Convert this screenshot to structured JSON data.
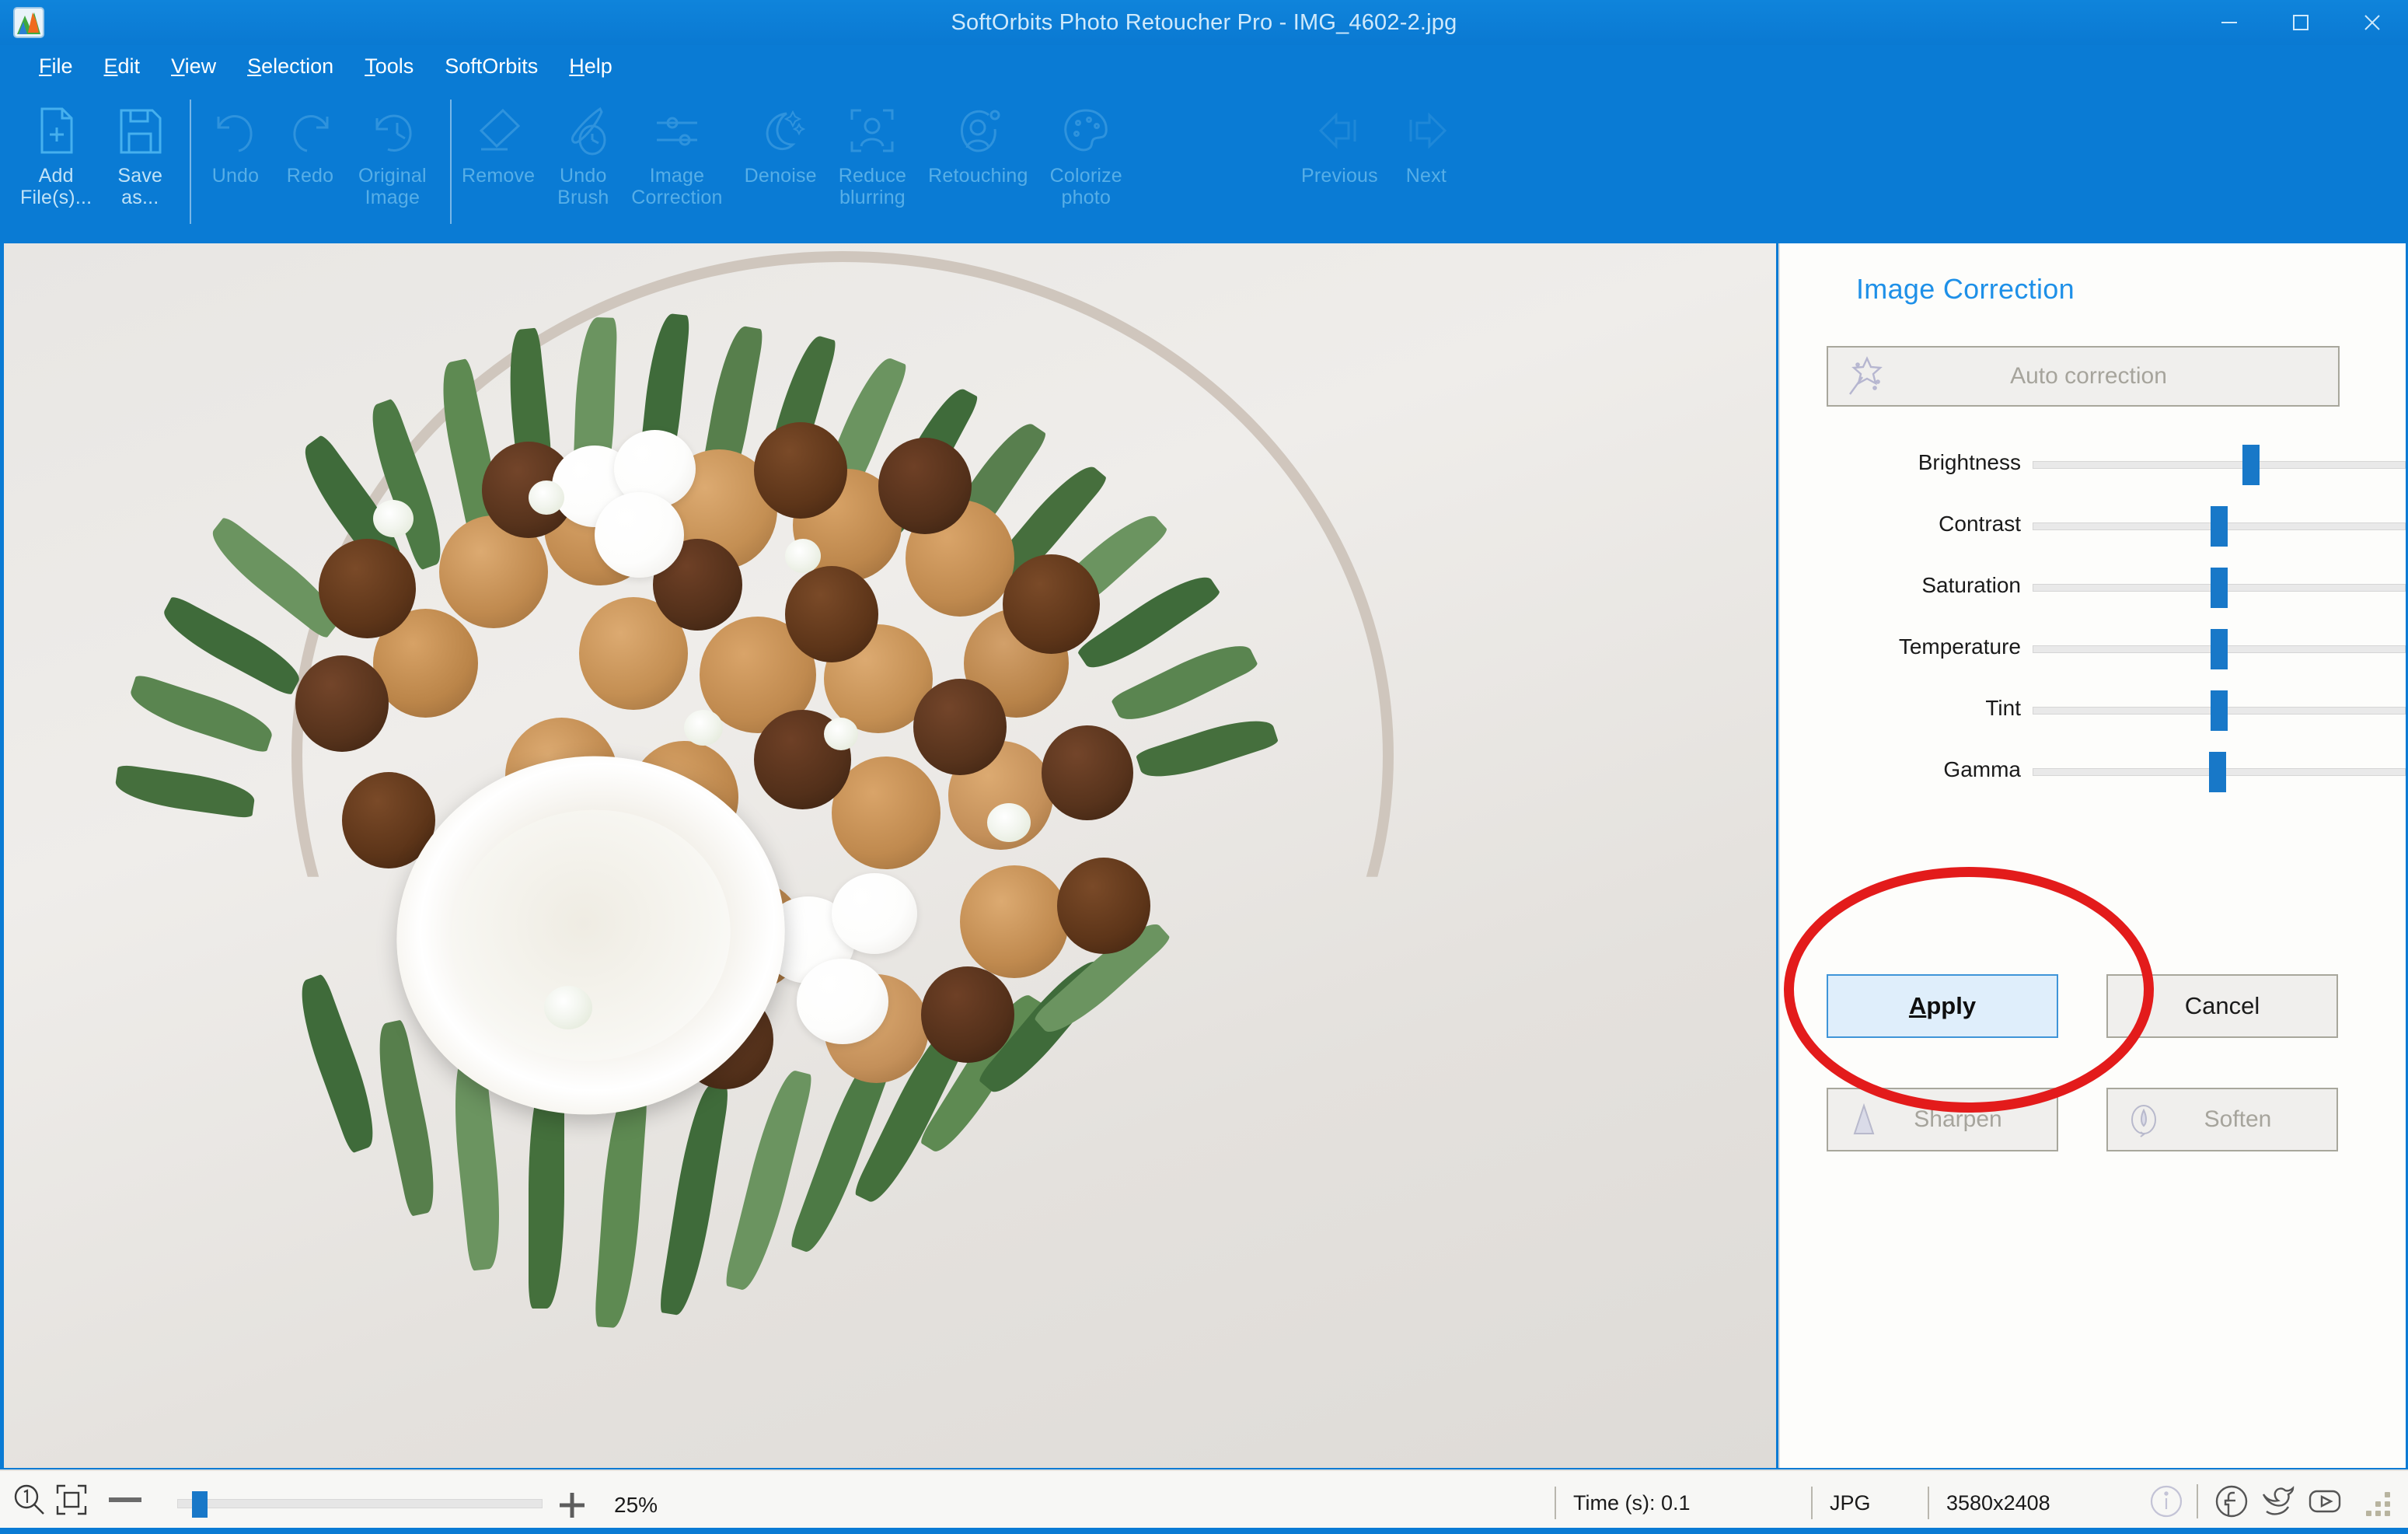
{
  "window": {
    "title": "SoftOrbits Photo Retoucher Pro - IMG_4602-2.jpg",
    "app_icon": "app-logo-icon",
    "minimize": "–",
    "maximize": "□",
    "close": "✕"
  },
  "menubar": {
    "items": [
      {
        "label": "File",
        "accel": "F"
      },
      {
        "label": "Edit",
        "accel": "E"
      },
      {
        "label": "View",
        "accel": "V"
      },
      {
        "label": "Selection",
        "accel": "S"
      },
      {
        "label": "Tools",
        "accel": "T"
      },
      {
        "label": "SoftOrbits",
        "accel": ""
      },
      {
        "label": "Help",
        "accel": "H"
      }
    ]
  },
  "toolbar": {
    "groups": [
      {
        "items": [
          {
            "label": "Add\nFile(s)...",
            "icon": "add-file-icon",
            "enabled": true
          },
          {
            "label": "Save\nas...",
            "icon": "save-as-icon",
            "enabled": true
          }
        ]
      },
      {
        "items": [
          {
            "label": "Undo",
            "icon": "undo-icon",
            "enabled": false
          },
          {
            "label": "Redo",
            "icon": "redo-icon",
            "enabled": false
          },
          {
            "label": "Original\nImage",
            "icon": "original-image-icon",
            "enabled": false
          }
        ]
      },
      {
        "items": [
          {
            "label": "Remove",
            "icon": "eraser-icon",
            "enabled": false
          },
          {
            "label": "Undo\nBrush",
            "icon": "undo-brush-icon",
            "enabled": false
          },
          {
            "label": "Image\nCorrection",
            "icon": "sliders-icon",
            "enabled": false
          },
          {
            "label": "Denoise",
            "icon": "moon-stars-icon",
            "enabled": false
          },
          {
            "label": "Reduce\nblurring",
            "icon": "focus-face-icon",
            "enabled": false
          },
          {
            "label": "Retouching",
            "icon": "retouch-face-icon",
            "enabled": false
          },
          {
            "label": "Colorize\nphoto",
            "icon": "palette-icon",
            "enabled": false
          }
        ]
      },
      {
        "items": [
          {
            "label": "Previous",
            "icon": "arrow-left-icon",
            "enabled": false
          },
          {
            "label": "Next",
            "icon": "arrow-right-icon",
            "enabled": false
          }
        ]
      }
    ]
  },
  "panel": {
    "title": "Image Correction",
    "auto_correction": {
      "label": "Auto correction",
      "icon": "magic-wand-icon",
      "enabled": false
    },
    "sliders": [
      {
        "label": "Brightness",
        "value": 58
      },
      {
        "label": "Contrast",
        "value": 50
      },
      {
        "label": "Saturation",
        "value": 50
      },
      {
        "label": "Temperature",
        "value": 50
      },
      {
        "label": "Tint",
        "value": 50
      },
      {
        "label": "Gamma",
        "value": 50
      }
    ],
    "apply": {
      "label": "Apply",
      "accel": "A"
    },
    "cancel": {
      "label": "Cancel"
    },
    "sharpen": {
      "label": "Sharpen",
      "icon": "sharpen-triangle-icon",
      "enabled": false
    },
    "soften": {
      "label": "Soften",
      "icon": "soften-drop-icon",
      "enabled": false
    }
  },
  "annotation": {
    "shape": "red-ellipse",
    "target": "apply-button",
    "color": "#e31b1b"
  },
  "statusbar": {
    "zoom_one_to_one_icon": "zoom-actual-size-icon",
    "fit_icon": "fit-to-window-icon",
    "minus_icon": "zoom-out-icon",
    "plus_icon": "zoom-in-icon",
    "zoom_value": "25%",
    "time_label": "Time (s): 0.1",
    "format": "JPG",
    "dimensions": "3580x2408",
    "info_icon": "info-icon",
    "facebook_icon": "facebook-icon",
    "twitter_icon": "twitter-icon",
    "youtube_icon": "youtube-icon",
    "grip": "resize-grip-icon"
  },
  "canvas": {
    "description": "Photograph of a decorative wreath arrangement with a halved coconut, walnuts, macadamia nuts, cotton bolls and rosemary foliage on a white background"
  },
  "colors": {
    "accent": "#0a7bd4",
    "panel_title": "#1e90e8",
    "slider_thumb": "#1878c8",
    "annotation_red": "#e31b1b"
  }
}
